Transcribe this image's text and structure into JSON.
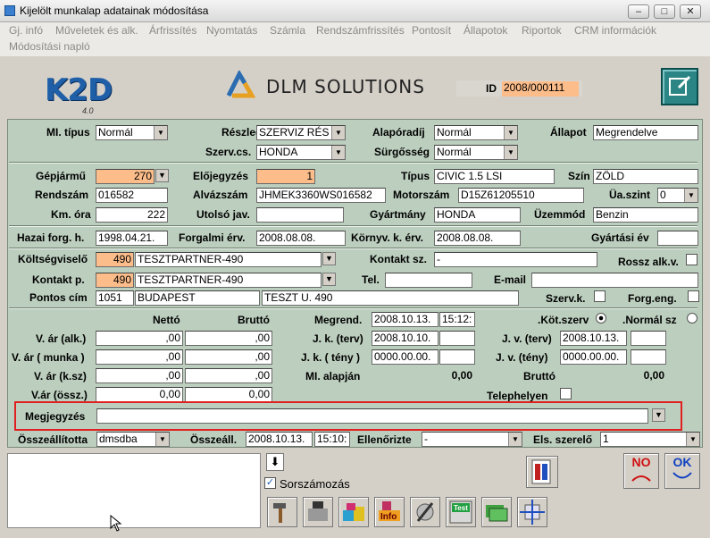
{
  "window": {
    "title": "Kijelölt munkalap adatainak módosítása"
  },
  "menu": [
    "Gj. infó",
    "Műveletek és alk.",
    "Árfrissítés",
    "Nyomtatás",
    "Számla",
    "Rendszámfrissítés",
    "Pontosít",
    "Állapotok",
    "Riportok",
    "CRM információk",
    "Módosítási napló"
  ],
  "logo": {
    "k2d": "K2D",
    "version": "4.0",
    "dlm": "DLM SOLUTIONS"
  },
  "id": {
    "label": "ID",
    "value": "2008/000111"
  },
  "row1": {
    "mi_tipus_label": "MI. típus",
    "mi_tipus": "Normál",
    "reszleg_label": "Részleg",
    "reszleg": "SZERVIZ RÉS",
    "alapordij_label": "Alapóradíj",
    "alapordij": "Normál",
    "allapot_label": "Állapot",
    "allapot": "Megrendelve",
    "szerv_label": "Szerv.cs.",
    "szerv": "HONDA",
    "surgosseg_label": "Sürgősség",
    "surgosseg": "Normál"
  },
  "vehicle": {
    "gepjarmu_label": "Gépjármű",
    "gepjarmu": "270",
    "elojegyzes_label": "Előjegyzés",
    "elojegyzes": "1",
    "tipus_label": "Típus",
    "tipus": "CIVIC 1.5 LSI",
    "szin_label": "Szín",
    "szin": "ZÖLD",
    "rendszam_label": "Rendszám",
    "rendszam": "016582",
    "alvazszam_label": "Alvázszám",
    "alvazszam": "JHMEK3360WS016582",
    "motorszam_label": "Motorszám",
    "motorszam": "D15Z61205510",
    "ua_label": "Üa.szint",
    "ua": "0",
    "km_label": "Km. óra",
    "km": "222",
    "utolso_label": "Utolsó jav.",
    "utolso": "",
    "gyartmany_label": "Gyártmány",
    "gyartmany": "HONDA",
    "uzemmod_label": "Üzemmód",
    "uzemmod": "Benzin"
  },
  "dates": {
    "hazai_label": "Hazai forg. h.",
    "hazai": "1998.04.21.",
    "forgalmi_label": "Forgalmi érv.",
    "forgalmi": "2008.08.08.",
    "kornyv_label": "Környv. k. érv.",
    "kornyv": "2008.08.08.",
    "gyartasi_label": "Gyártási év",
    "gyartasi": ""
  },
  "partner": {
    "koltseg_label": "Költségviselő",
    "koltseg_code": "490",
    "koltseg_name": "TESZTPARTNER-490",
    "kontakt_sz_label": "Kontakt sz.",
    "kontakt_sz": "-",
    "rossz_label": "Rossz alk.v.",
    "kontakt_p_label": "Kontakt p.",
    "kontakt_p_code": "490",
    "kontakt_p_name": "TESZTPARTNER-490",
    "tel_label": "Tel.",
    "tel": "",
    "email_label": "E-mail",
    "email": "",
    "cim_label": "Pontos cím",
    "zip": "1051",
    "city": "BUDAPEST",
    "street": "TESZT U. 490",
    "szervk_label": "Szerv.k.",
    "forg_label": "Forg.eng."
  },
  "prices": {
    "netto_h": "Nettó",
    "brutto_h": "Bruttó",
    "v_alk_label": "V. ár (alk.)",
    "v_alk_n": ",00",
    "v_alk_b": ",00",
    "v_munka_label": "V. ár ( munka )",
    "v_munka_n": ",00",
    "v_munka_b": ",00",
    "v_ksz_label": "V. ár (k.sz)",
    "v_ksz_n": ",00",
    "v_ksz_b": ",00",
    "v_ossz_label": "V.ár (össz.)",
    "v_ossz_n": "0,00",
    "v_ossz_b": "0,00",
    "megrend_label": "Megrend.",
    "megrend_date": "2008.10.13.",
    "megrend_time": "15:12:",
    "jk_terv_label": "J. k. (terv)",
    "jk_terv": "2008.10.10.",
    "jk_teny_label": "J. k. ( tény )",
    "jk_teny": "0000.00.00.",
    "mi_alapjan_label": "MI. alapján",
    "mi_alapjan": "0,00",
    "kot_label": ".Köt.szerv",
    "normal_label": ".Normál sz",
    "jv_terv_label": "J. v. (terv)",
    "jv_terv": "2008.10.13.",
    "jv_teny_label": "J. v. (tény)",
    "jv_teny": "0000.00.00.",
    "brutto_label": "Bruttó",
    "brutto": "0,00",
    "telephelyen_label": "Telephelyen"
  },
  "note": {
    "label": "Megjegyzés",
    "value": ""
  },
  "footer": {
    "ossze_label": "Összeállította",
    "ossze": "dmsdba",
    "osszeall_label": "Összeáll.",
    "osszeall_date": "2008.10.13.",
    "osszeall_time": "15:10:",
    "ellen_label": "Ellenőrizte",
    "ellen": "-",
    "els_label": "Els. szerelő",
    "els": "1"
  },
  "bottom": {
    "sorszamozas": "Sorszámozás",
    "no": "NO",
    "ok": "OK"
  },
  "colors": {
    "form_bg": "#bccebe",
    "orange": "#fdbd8a",
    "highlight": "#e02020"
  }
}
